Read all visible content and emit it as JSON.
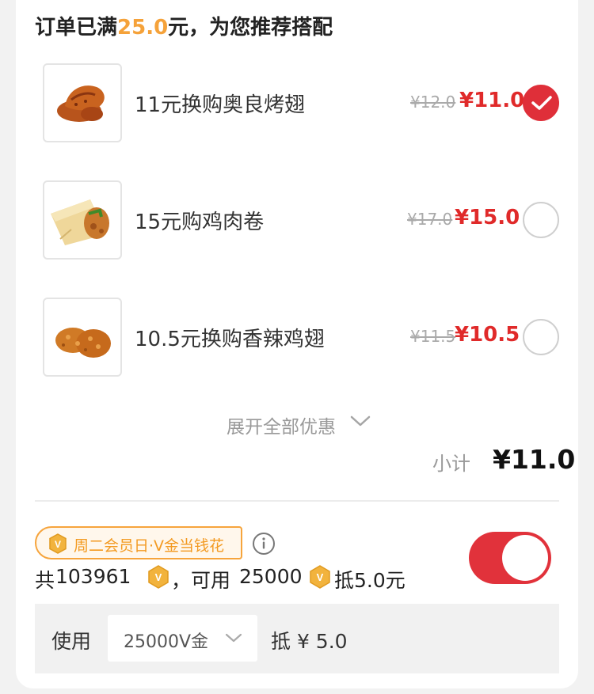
{
  "header": {
    "prefix": "订单已满",
    "amount": "25.0",
    "suffix": "元，为您推荐搭配"
  },
  "items": [
    {
      "title": "11元换购奥良烤翅",
      "original_price": "¥12.0",
      "price": "¥11.0",
      "selected": true,
      "image": "roasted-wing-image"
    },
    {
      "title": "15元购鸡肉卷",
      "original_price": "¥17.0",
      "price": "¥15.0",
      "selected": false,
      "image": "chicken-wrap-image"
    },
    {
      "title": "10.5元换购香辣鸡翅",
      "original_price": "¥11.5",
      "price": "¥10.5",
      "selected": false,
      "image": "spicy-wing-image"
    }
  ],
  "expand": {
    "label": "展开全部优惠",
    "icon": "chevron-down-icon"
  },
  "subtotal": {
    "label": "小计",
    "value": "¥11.0"
  },
  "vgold": {
    "promo_tag": "周二会员日·V金当钱花",
    "balance_prefix": "共",
    "balance_total": "103961",
    "available_prefix": "，可用",
    "available_amount": "25000",
    "deduct_text": "抵5.0元",
    "toggle_on": true,
    "use_label": "使用",
    "select_value": "25000V金",
    "deduct_amount_text": "抵 ¥ 5.0"
  },
  "colors": {
    "accent_red": "#df2f39",
    "promo_orange": "#f5a23a",
    "muted_gray": "#999999",
    "coin_gold": "#f2b33d"
  }
}
